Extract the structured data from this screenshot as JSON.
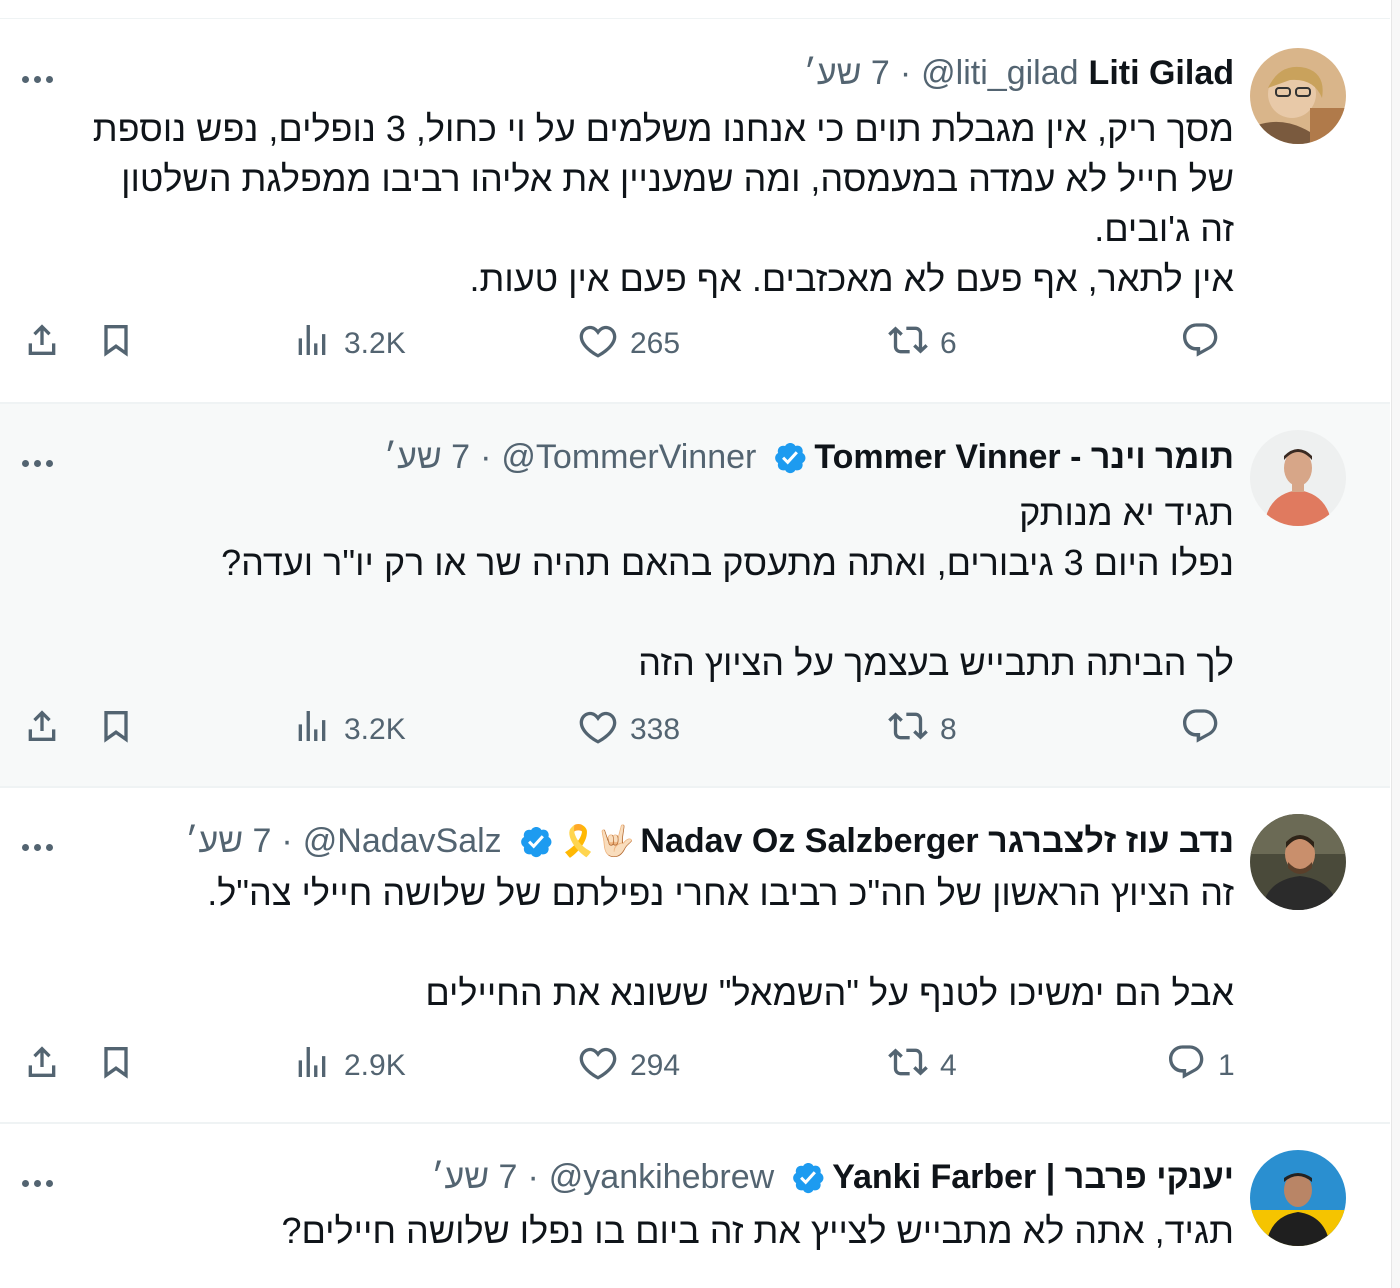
{
  "more_label": "•••",
  "colors": {
    "verified": "#1d9bf0",
    "secondary": "#536471",
    "divider": "#eff3f4"
  },
  "tweets": [
    {
      "name": "Liti Gilad",
      "handle": "@liti_gilad",
      "dot": "·",
      "time": "7 שע׳",
      "verified": false,
      "emojis": "",
      "text": [
        "מסך ריק, אין מגבלת תוים כי אנחנו משלמים על וי כחול, 3 נופלים, נפש נוספת",
        "של חייל לא עמדה במעמסה, ומה שמעניין את אליהו רביבו ממפלגת השלטון",
        "זה ג'ובים.",
        "אין לתאר, אף פעם לא מאכזבים. אף פעם אין טעות."
      ],
      "replies": "",
      "retweets": "6",
      "likes": "265",
      "views": "3.2K"
    },
    {
      "name": "תומר וינר - Tommer Vinner",
      "handle": "@TommerVinner",
      "dot": "·",
      "time": "7 שע׳",
      "verified": true,
      "emojis": "",
      "text": [
        "תגיד יא מנותק",
        "נפלו היום 3 גיבורים, ואתה מתעסק בהאם תהיה שר או רק יו\"ר ועדה?",
        "",
        "לך הביתה תתבייש בעצמך על הציוץ הזה"
      ],
      "replies": "",
      "retweets": "8",
      "likes": "338",
      "views": "3.2K"
    },
    {
      "name": "נדב עוז זלצברגר Nadav Oz Salzberger",
      "handle": "@NadavSalz",
      "dot": "·",
      "time": "7 שע׳",
      "verified": true,
      "emojis": "🎗️🤟🏻",
      "text": [
        "זה הציוץ הראשון של חה\"כ רביבו אחרי נפילתם של שלושה חיילי צה\"ל.",
        "",
        "אבל הם ימשיכו לטנף על \"השמאל\" ששונא את החיילים"
      ],
      "replies": "1",
      "retweets": "4",
      "likes": "294",
      "views": "2.9K"
    },
    {
      "name": "יענקי פרבר | Yanki Farber",
      "handle": "@yankihebrew",
      "dot": "·",
      "time": "7 שע׳",
      "verified": true,
      "emojis": "",
      "text": [
        "תגיד, אתה לא מתבייש לצייץ את זה ביום בו נפלו שלושה חיילים?"
      ],
      "replies": "",
      "retweets": "",
      "likes": "",
      "views": ""
    }
  ]
}
